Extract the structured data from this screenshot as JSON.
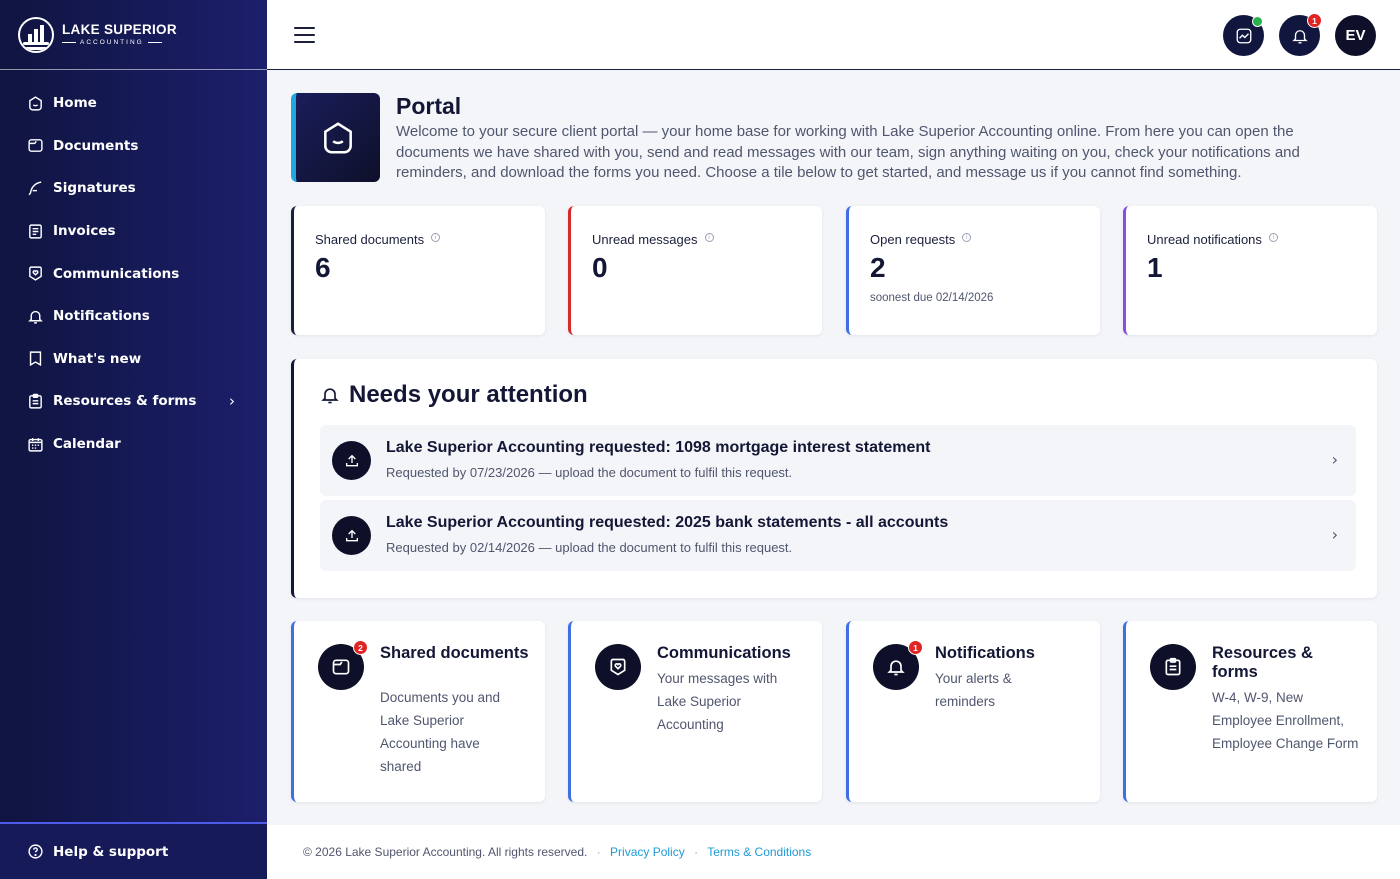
{
  "brand": {
    "name": "LAKE SUPERIOR",
    "sub": "ACCOUNTING"
  },
  "sidebar": {
    "items": [
      {
        "label": "Home",
        "icon": "home-icon"
      },
      {
        "label": "Documents",
        "icon": "folder-icon"
      },
      {
        "label": "Signatures",
        "icon": "feather-icon"
      },
      {
        "label": "Invoices",
        "icon": "invoice-icon"
      },
      {
        "label": "Communications",
        "icon": "heart-chat-icon"
      },
      {
        "label": "Notifications",
        "icon": "bell-icon"
      },
      {
        "label": "What's new",
        "icon": "bookmark-icon"
      },
      {
        "label": "Resources & forms",
        "icon": "clipboard-icon"
      },
      {
        "label": "Calendar",
        "icon": "calendar-icon"
      }
    ],
    "footer": {
      "label": "Help & support",
      "icon": "help-icon"
    }
  },
  "topbar": {
    "notifications_badge": "1",
    "avatar_initials": "EV"
  },
  "portal": {
    "title": "Portal",
    "description": "Welcome to your secure client portal — your home base for working with Lake Superior Accounting online. From here you can open the documents we have shared with you, send and read messages with our team, sign anything waiting on you, check your notifications and reminders, and download the forms you need. Choose a tile below to get started, and message us if you cannot find something."
  },
  "stats": [
    {
      "label": "Shared documents",
      "value": "6",
      "sub": "",
      "color": "#1b1f3b"
    },
    {
      "label": "Unread messages",
      "value": "0",
      "sub": "",
      "color": "#d42a2a"
    },
    {
      "label": "Open requests",
      "value": "2",
      "sub": "soonest due 02/14/2026",
      "color": "#3f6fe0"
    },
    {
      "label": "Unread notifications",
      "value": "1",
      "sub": "",
      "color": "#8a4de0"
    }
  ],
  "attention": {
    "title": "Needs your attention",
    "requests": [
      {
        "title": "Lake Superior Accounting requested: 1098 mortgage interest statement",
        "sub": "Requested by 07/23/2026 — upload the document to fulfil this request."
      },
      {
        "title": "Lake Superior Accounting requested: 2025 bank statements - all accounts",
        "sub": "Requested by 02/14/2026 — upload the document to fulfil this request."
      }
    ]
  },
  "tiles": [
    {
      "title": "Shared documents",
      "desc": "Documents you and Lake Superior Accounting have shared",
      "badge": "2",
      "icon": "folder-icon"
    },
    {
      "title": "Communications",
      "desc": "Your messages with Lake Superior Accounting",
      "badge": "",
      "icon": "heart-chat-icon"
    },
    {
      "title": "Notifications",
      "desc": "Your alerts & reminders",
      "badge": "1",
      "icon": "bell-icon"
    },
    {
      "title": "Resources & forms",
      "desc": "W-4, W-9, New Employee Enrollment, Employee Change Form",
      "badge": "",
      "icon": "clipboard-icon"
    }
  ],
  "footer": {
    "copyright": "© 2026 Lake Superior Accounting. All rights reserved.",
    "sep1": "·",
    "privacy": "Privacy Policy",
    "sep2": "·",
    "terms": "Terms & Conditions"
  }
}
